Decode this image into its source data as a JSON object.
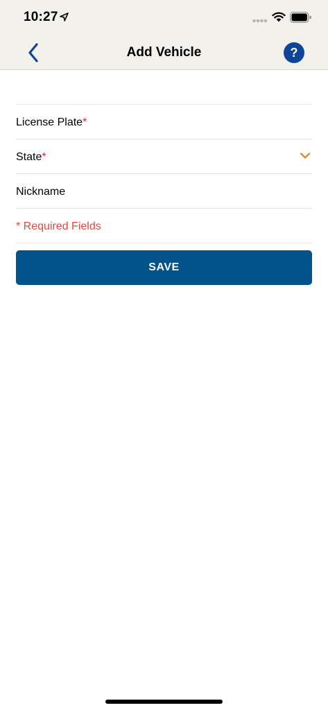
{
  "status_bar": {
    "time": "10:27"
  },
  "nav": {
    "title": "Add Vehicle",
    "help_label": "?"
  },
  "form": {
    "license_plate_label": "License Plate",
    "state_label": "State",
    "nickname_label": "Nickname",
    "required_star": "*",
    "required_note": "* Required Fields"
  },
  "actions": {
    "save_label": "SAVE"
  },
  "colors": {
    "header_bg": "#f2f1ec",
    "accent_blue": "#0f4597",
    "save_button": "#02528c",
    "required_red": "#e0262a",
    "chevron_orange": "#e8892b"
  }
}
